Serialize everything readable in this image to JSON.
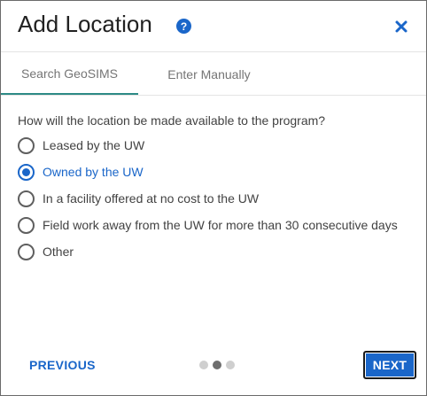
{
  "dialog": {
    "title": "Add Location",
    "help_icon_glyph": "?",
    "close_icon": "close-icon",
    "accent_color": "#1a66c9",
    "tab_indicator_color": "#2d8a86"
  },
  "tabs": [
    {
      "label": "Search GeoSIMS",
      "active": true
    },
    {
      "label": "Enter Manually",
      "active": false
    }
  ],
  "question": "How will the location be made available to the program?",
  "options": [
    {
      "label": "Leased by the UW",
      "selected": false
    },
    {
      "label": "Owned by the UW",
      "selected": true
    },
    {
      "label": "In a facility offered at no cost to the UW",
      "selected": false
    },
    {
      "label": "Field work away from the UW for more than 30 consecutive days",
      "selected": false
    },
    {
      "label": "Other",
      "selected": false
    }
  ],
  "footer": {
    "previous_label": "PREVIOUS",
    "next_label": "NEXT",
    "step_total": 3,
    "step_current": 2
  }
}
